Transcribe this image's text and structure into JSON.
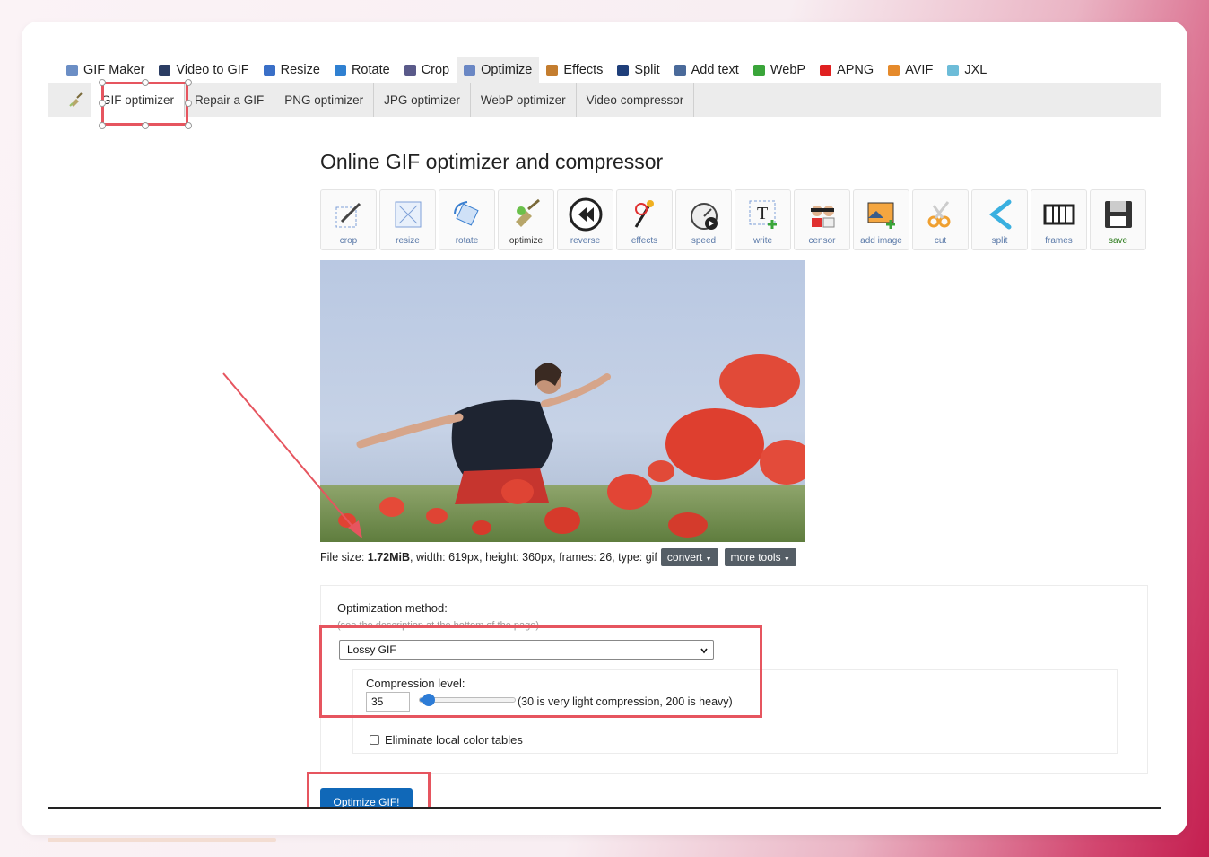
{
  "nav": [
    {
      "label": "GIF Maker",
      "icon": "gif-maker-icon",
      "color": "#6b8ec5"
    },
    {
      "label": "Video to GIF",
      "icon": "film-icon",
      "color": "#2b3d63"
    },
    {
      "label": "Resize",
      "icon": "resize-icon",
      "color": "#3a6fc7"
    },
    {
      "label": "Rotate",
      "icon": "rotate-icon",
      "color": "#2f80d1"
    },
    {
      "label": "Crop",
      "icon": "crop-icon",
      "color": "#5a5a8a"
    },
    {
      "label": "Optimize",
      "icon": "optimize-icon",
      "color": "#6a87c4",
      "active": true
    },
    {
      "label": "Effects",
      "icon": "effects-icon",
      "color": "#c47d2f"
    },
    {
      "label": "Split",
      "icon": "split-icon",
      "color": "#1f3f7a"
    },
    {
      "label": "Add text",
      "icon": "add-text-icon",
      "color": "#4a6a9a"
    },
    {
      "label": "WebP",
      "icon": "webp-icon",
      "color": "#3aa53a"
    },
    {
      "label": "APNG",
      "icon": "apng-icon",
      "color": "#e02020"
    },
    {
      "label": "AVIF",
      "icon": "avif-icon",
      "color": "#e58a2b"
    },
    {
      "label": "JXL",
      "icon": "jxl-icon",
      "color": "#6dbcd8"
    }
  ],
  "subnav": [
    "GIF optimizer",
    "Repair a GIF",
    "PNG optimizer",
    "JPG optimizer",
    "WebP optimizer",
    "Video compressor"
  ],
  "page_title": "Online GIF optimizer and compressor",
  "tools": [
    {
      "label": "crop",
      "icon": "crop-tool-icon"
    },
    {
      "label": "resize",
      "icon": "resize-tool-icon"
    },
    {
      "label": "rotate",
      "icon": "rotate-tool-icon"
    },
    {
      "label": "optimize",
      "icon": "optimize-tool-icon",
      "style": "dark"
    },
    {
      "label": "reverse",
      "icon": "reverse-icon"
    },
    {
      "label": "effects",
      "icon": "effects-tool-icon"
    },
    {
      "label": "speed",
      "icon": "speed-icon"
    },
    {
      "label": "write",
      "icon": "write-icon"
    },
    {
      "label": "censor",
      "icon": "censor-icon"
    },
    {
      "label": "add image",
      "icon": "add-image-icon"
    },
    {
      "label": "cut",
      "icon": "cut-icon"
    },
    {
      "label": "split",
      "icon": "split-tool-icon"
    },
    {
      "label": "frames",
      "icon": "frames-icon"
    },
    {
      "label": "save",
      "icon": "save-icon",
      "style": "green"
    }
  ],
  "file_info": {
    "prefix": "File size: ",
    "size": "1.72MiB",
    "details": ", width: 619px, height: 360px, frames: 26, type: gif"
  },
  "buttons": {
    "convert": "convert",
    "more_tools": "more tools",
    "optimize": "Optimize GIF!"
  },
  "options": {
    "method_label": "Optimization method:",
    "method_hint": "(see the description at the bottom of the page)",
    "method_value": "Lossy GIF",
    "compression_label": "Compression level:",
    "compression_value": "35",
    "compression_hint": "(30 is very light compression, 200 is heavy)",
    "compression_min": 30,
    "compression_max": 200,
    "eliminate_label": "Eliminate local color tables"
  },
  "colors": {
    "highlight": "#e6555f",
    "primary": "#1068b8",
    "dark_button": "#555e66"
  }
}
